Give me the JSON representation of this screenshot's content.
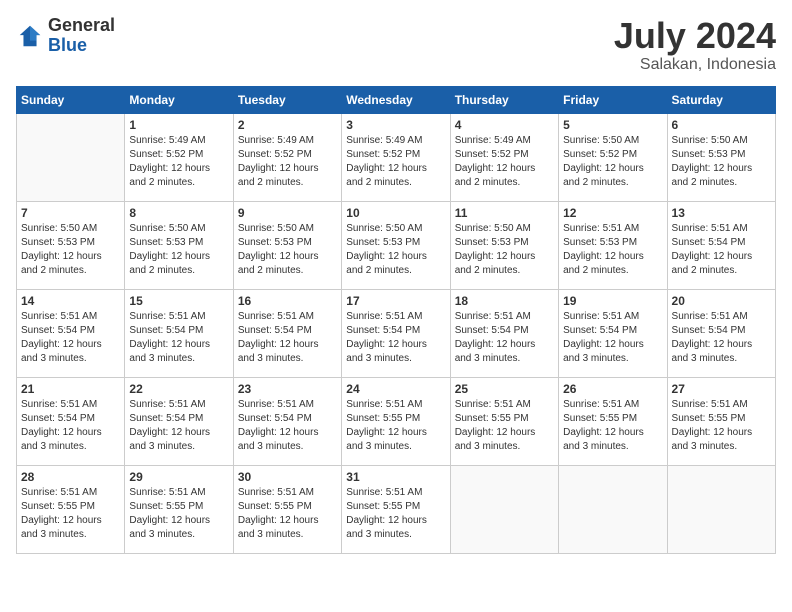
{
  "header": {
    "logo_general": "General",
    "logo_blue": "Blue",
    "main_title": "July 2024",
    "subtitle": "Salakan, Indonesia"
  },
  "calendar": {
    "days_of_week": [
      "Sunday",
      "Monday",
      "Tuesday",
      "Wednesday",
      "Thursday",
      "Friday",
      "Saturday"
    ],
    "weeks": [
      [
        {
          "day": "",
          "info": ""
        },
        {
          "day": "1",
          "info": "Sunrise: 5:49 AM\nSunset: 5:52 PM\nDaylight: 12 hours\nand 2 minutes."
        },
        {
          "day": "2",
          "info": "Sunrise: 5:49 AM\nSunset: 5:52 PM\nDaylight: 12 hours\nand 2 minutes."
        },
        {
          "day": "3",
          "info": "Sunrise: 5:49 AM\nSunset: 5:52 PM\nDaylight: 12 hours\nand 2 minutes."
        },
        {
          "day": "4",
          "info": "Sunrise: 5:49 AM\nSunset: 5:52 PM\nDaylight: 12 hours\nand 2 minutes."
        },
        {
          "day": "5",
          "info": "Sunrise: 5:50 AM\nSunset: 5:52 PM\nDaylight: 12 hours\nand 2 minutes."
        },
        {
          "day": "6",
          "info": "Sunrise: 5:50 AM\nSunset: 5:53 PM\nDaylight: 12 hours\nand 2 minutes."
        }
      ],
      [
        {
          "day": "7",
          "info": "Sunrise: 5:50 AM\nSunset: 5:53 PM\nDaylight: 12 hours\nand 2 minutes."
        },
        {
          "day": "8",
          "info": "Sunrise: 5:50 AM\nSunset: 5:53 PM\nDaylight: 12 hours\nand 2 minutes."
        },
        {
          "day": "9",
          "info": "Sunrise: 5:50 AM\nSunset: 5:53 PM\nDaylight: 12 hours\nand 2 minutes."
        },
        {
          "day": "10",
          "info": "Sunrise: 5:50 AM\nSunset: 5:53 PM\nDaylight: 12 hours\nand 2 minutes."
        },
        {
          "day": "11",
          "info": "Sunrise: 5:50 AM\nSunset: 5:53 PM\nDaylight: 12 hours\nand 2 minutes."
        },
        {
          "day": "12",
          "info": "Sunrise: 5:51 AM\nSunset: 5:53 PM\nDaylight: 12 hours\nand 2 minutes."
        },
        {
          "day": "13",
          "info": "Sunrise: 5:51 AM\nSunset: 5:54 PM\nDaylight: 12 hours\nand 2 minutes."
        }
      ],
      [
        {
          "day": "14",
          "info": "Sunrise: 5:51 AM\nSunset: 5:54 PM\nDaylight: 12 hours\nand 3 minutes."
        },
        {
          "day": "15",
          "info": "Sunrise: 5:51 AM\nSunset: 5:54 PM\nDaylight: 12 hours\nand 3 minutes."
        },
        {
          "day": "16",
          "info": "Sunrise: 5:51 AM\nSunset: 5:54 PM\nDaylight: 12 hours\nand 3 minutes."
        },
        {
          "day": "17",
          "info": "Sunrise: 5:51 AM\nSunset: 5:54 PM\nDaylight: 12 hours\nand 3 minutes."
        },
        {
          "day": "18",
          "info": "Sunrise: 5:51 AM\nSunset: 5:54 PM\nDaylight: 12 hours\nand 3 minutes."
        },
        {
          "day": "19",
          "info": "Sunrise: 5:51 AM\nSunset: 5:54 PM\nDaylight: 12 hours\nand 3 minutes."
        },
        {
          "day": "20",
          "info": "Sunrise: 5:51 AM\nSunset: 5:54 PM\nDaylight: 12 hours\nand 3 minutes."
        }
      ],
      [
        {
          "day": "21",
          "info": "Sunrise: 5:51 AM\nSunset: 5:54 PM\nDaylight: 12 hours\nand 3 minutes."
        },
        {
          "day": "22",
          "info": "Sunrise: 5:51 AM\nSunset: 5:54 PM\nDaylight: 12 hours\nand 3 minutes."
        },
        {
          "day": "23",
          "info": "Sunrise: 5:51 AM\nSunset: 5:54 PM\nDaylight: 12 hours\nand 3 minutes."
        },
        {
          "day": "24",
          "info": "Sunrise: 5:51 AM\nSunset: 5:55 PM\nDaylight: 12 hours\nand 3 minutes."
        },
        {
          "day": "25",
          "info": "Sunrise: 5:51 AM\nSunset: 5:55 PM\nDaylight: 12 hours\nand 3 minutes."
        },
        {
          "day": "26",
          "info": "Sunrise: 5:51 AM\nSunset: 5:55 PM\nDaylight: 12 hours\nand 3 minutes."
        },
        {
          "day": "27",
          "info": "Sunrise: 5:51 AM\nSunset: 5:55 PM\nDaylight: 12 hours\nand 3 minutes."
        }
      ],
      [
        {
          "day": "28",
          "info": "Sunrise: 5:51 AM\nSunset: 5:55 PM\nDaylight: 12 hours\nand 3 minutes."
        },
        {
          "day": "29",
          "info": "Sunrise: 5:51 AM\nSunset: 5:55 PM\nDaylight: 12 hours\nand 3 minutes."
        },
        {
          "day": "30",
          "info": "Sunrise: 5:51 AM\nSunset: 5:55 PM\nDaylight: 12 hours\nand 3 minutes."
        },
        {
          "day": "31",
          "info": "Sunrise: 5:51 AM\nSunset: 5:55 PM\nDaylight: 12 hours\nand 3 minutes."
        },
        {
          "day": "",
          "info": ""
        },
        {
          "day": "",
          "info": ""
        },
        {
          "day": "",
          "info": ""
        }
      ]
    ]
  }
}
